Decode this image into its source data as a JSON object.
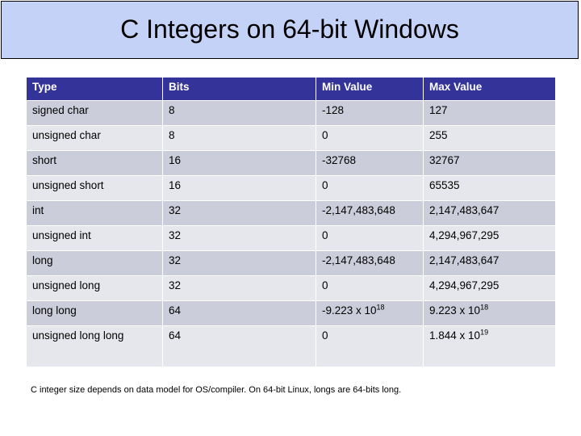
{
  "slide": {
    "title": "C Integers on 64-bit Windows",
    "title_bg": "#c5d2f8",
    "title_border": "#000000"
  },
  "table": {
    "header_bg": "#333399",
    "header_fg": "#ffffff",
    "row_bg_odd": "#cccdda",
    "row_bg_even": "#e6e7ec",
    "columns": [
      "Type",
      "Bits",
      "Min Value",
      "Max Value"
    ],
    "rows": [
      {
        "type": "signed char",
        "bits": "8",
        "min": "-128",
        "min_sup": "",
        "max": "127",
        "max_sup": ""
      },
      {
        "type": "unsigned char",
        "bits": "8",
        "min": "0",
        "min_sup": "",
        "max": "255",
        "max_sup": ""
      },
      {
        "type": "short",
        "bits": "16",
        "min": "-32768",
        "min_sup": "",
        "max": "32767",
        "max_sup": ""
      },
      {
        "type": "unsigned short",
        "bits": "16",
        "min": "0",
        "min_sup": "",
        "max": "65535",
        "max_sup": ""
      },
      {
        "type": "int",
        "bits": "32",
        "min": "-2,147,483,648",
        "min_sup": "",
        "max": "2,147,483,647",
        "max_sup": ""
      },
      {
        "type": "unsigned int",
        "bits": "32",
        "min": "0",
        "min_sup": "",
        "max": "4,294,967,295",
        "max_sup": ""
      },
      {
        "type": "long",
        "bits": "32",
        "min": "-2,147,483,648",
        "min_sup": "",
        "max": "2,147,483,647",
        "max_sup": ""
      },
      {
        "type": "unsigned long",
        "bits": "32",
        "min": "0",
        "min_sup": "",
        "max": "4,294,967,295",
        "max_sup": ""
      },
      {
        "type": "long long",
        "bits": "64",
        "min": "-9.223 x 10",
        "min_sup": "18",
        "max": "9.223 x 10",
        "max_sup": "18"
      },
      {
        "type": "unsigned long long",
        "bits": "64",
        "min": "0",
        "min_sup": "",
        "max": "1.844 x 10",
        "max_sup": "19"
      }
    ]
  },
  "footnote": {
    "text": "C integer size depends on data model for OS/compiler.  On 64-bit Linux, longs are 64-bits long."
  }
}
